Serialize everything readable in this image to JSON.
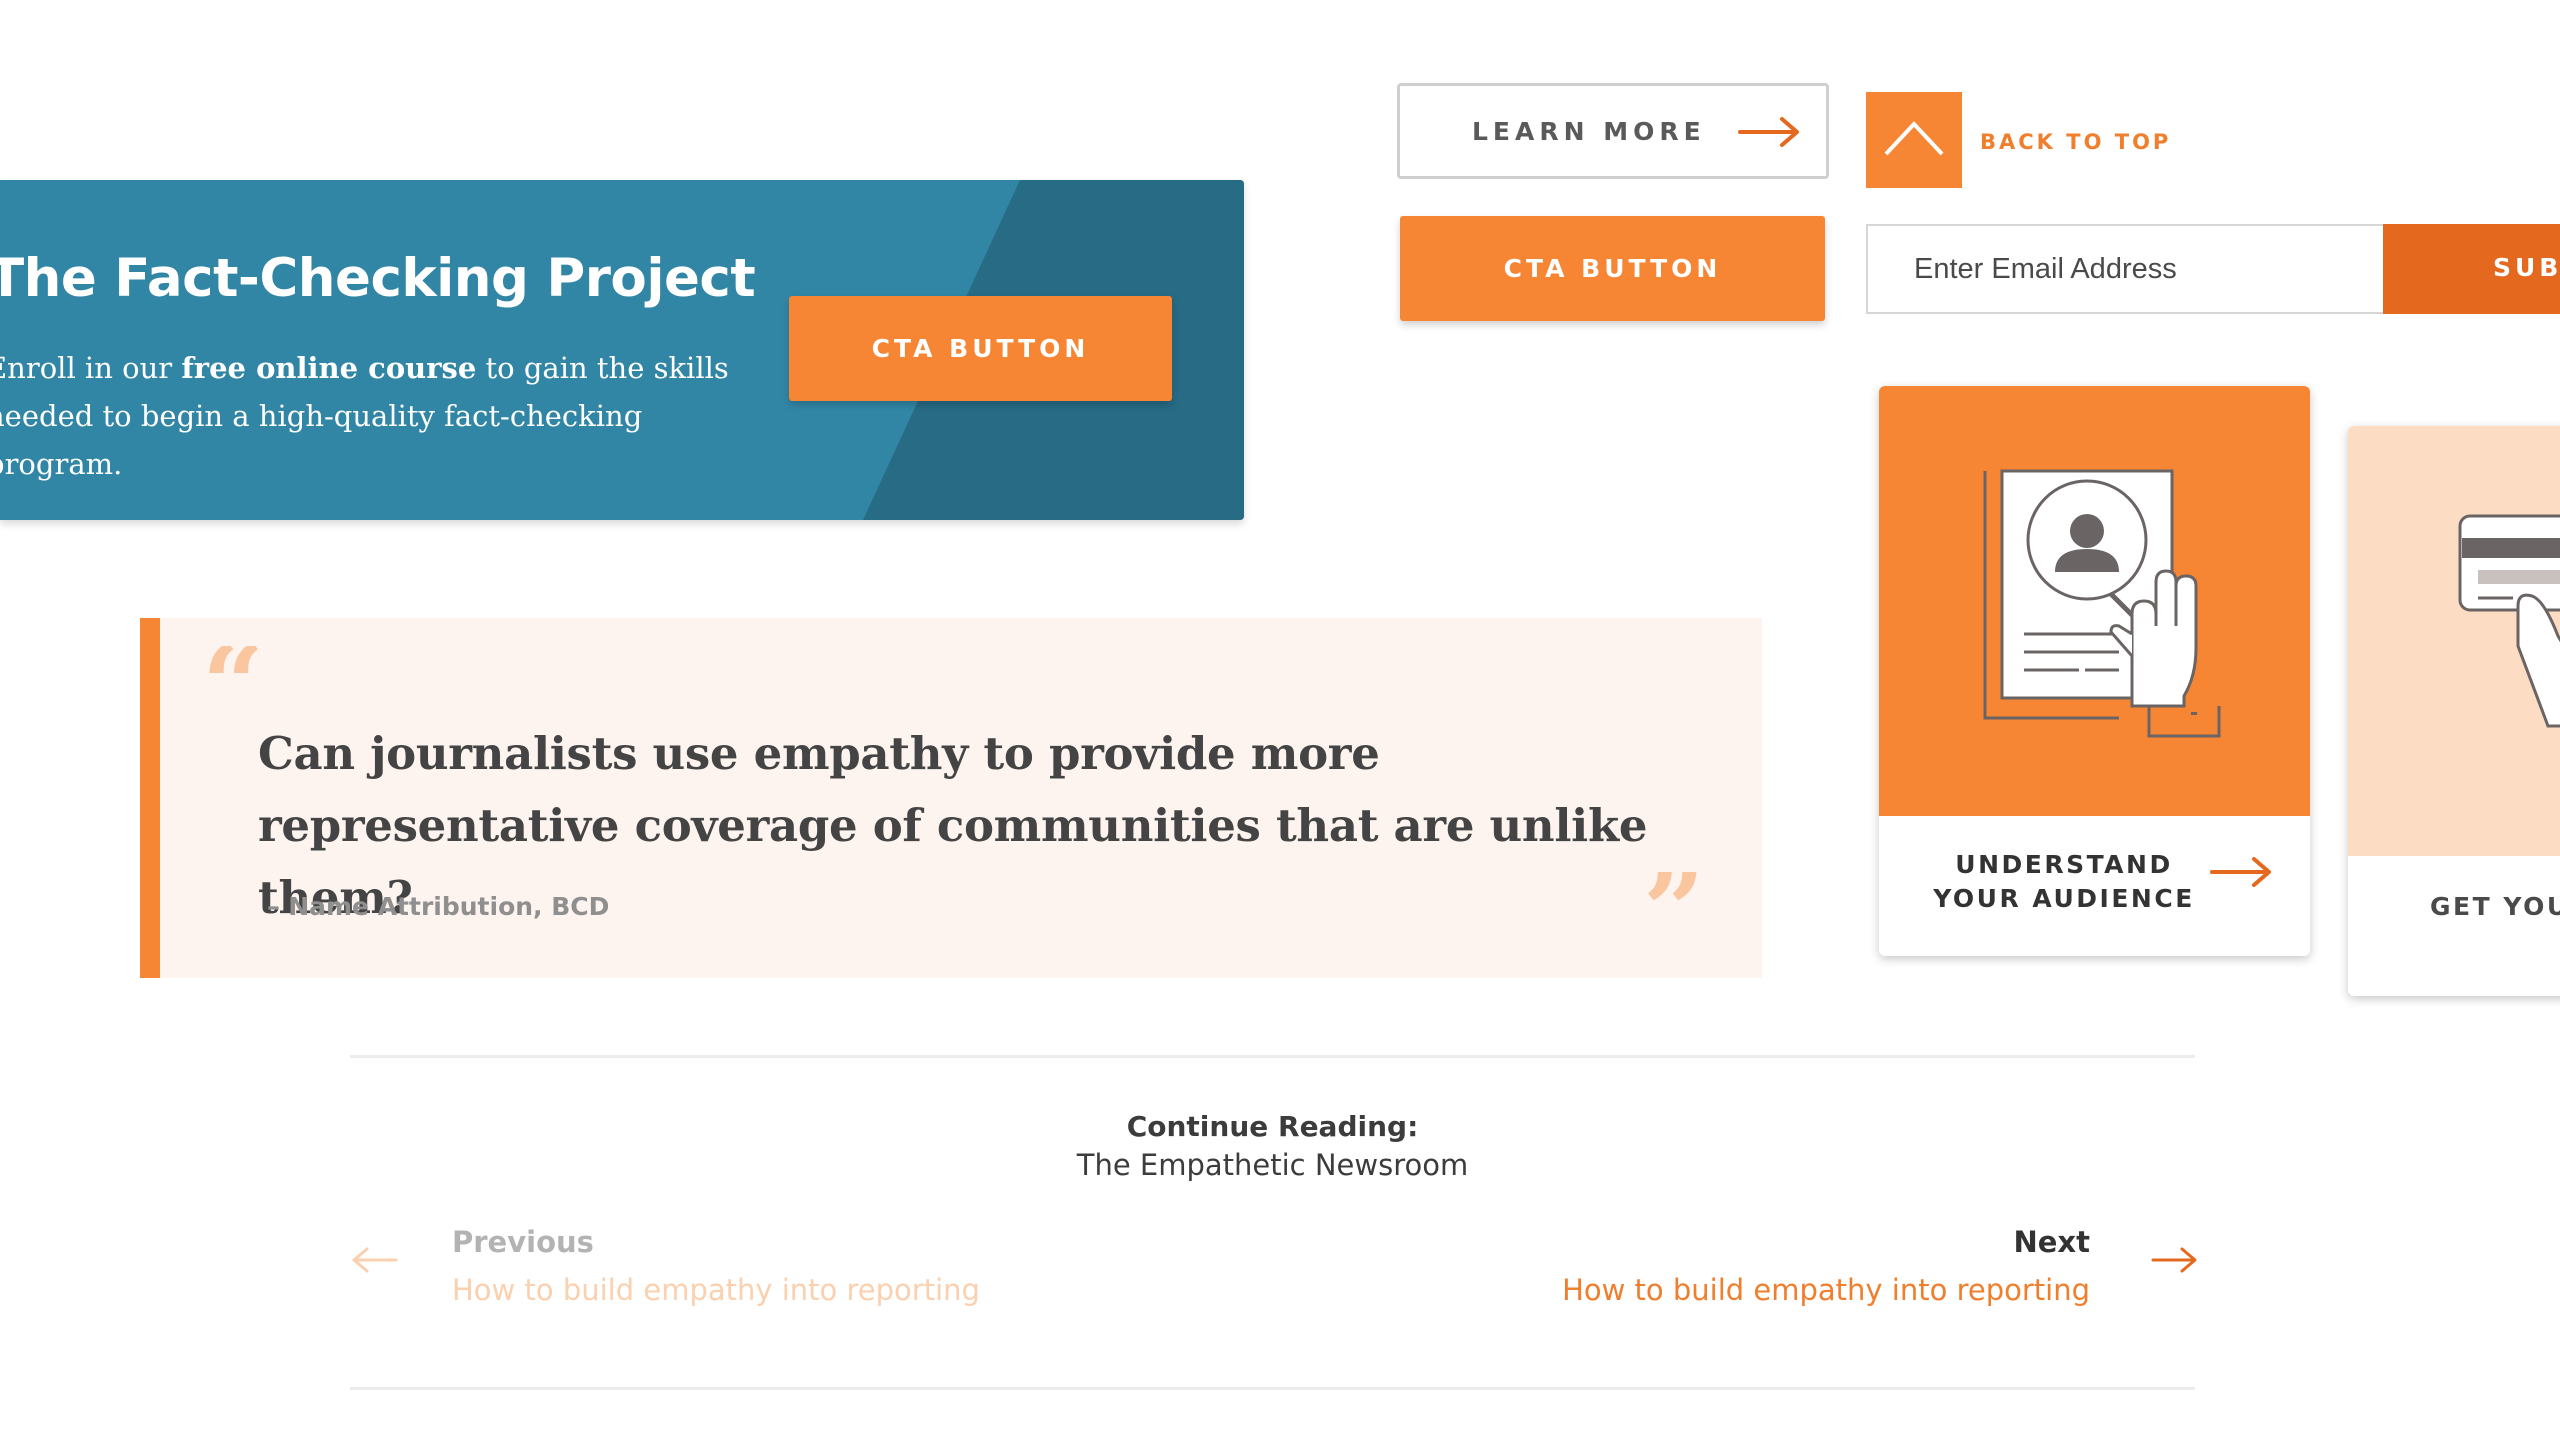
{
  "colors": {
    "accent_orange": "#f68634",
    "dark_orange": "#e4691e",
    "banner_blue": "#3186a6",
    "banner_dark_blue": "#276b85",
    "quote_background": "#fdf3ef",
    "peach": "#fddcc4"
  },
  "buttons": {
    "learn_more": "LEARN MORE",
    "cta": "CTA BUTTON",
    "back_to_top": "BACK TO TOP"
  },
  "icons": {
    "learn_more": "arrow-right-icon",
    "back_to_top": "chevron-up-icon",
    "quote_open": "open-quote-icon",
    "quote_close": "close-quote-icon",
    "card": "arrow-right-icon",
    "previous": "arrow-left-icon",
    "next": "arrow-right-icon"
  },
  "subscribe": {
    "placeholder": "Enter Email Address",
    "button_label": "SUBSCRIBE"
  },
  "banner": {
    "title": "The Fact-Checking Project",
    "desc_before": "Enroll in our ",
    "desc_bold": "free online course",
    "desc_after": " to gain the skills needed to begin a high-quality fact-checking program.",
    "cta_label": "CTA BUTTON"
  },
  "quote": {
    "text": "Can journalists use empathy to provide more representative coverage of communities that are unlike them?",
    "attribution": "– Name Attribution, BCD"
  },
  "cards": [
    {
      "title": "UNDERSTAND YOUR AUDIENCE",
      "illustration": "profile-document-magnifier-icon"
    },
    {
      "title": "GET YOUR AUDIENCE",
      "illustration": "credit-card-hand-icon"
    }
  ],
  "continue_reading": {
    "label": "Continue Reading:",
    "series": "The Empathetic Newsroom",
    "previous": {
      "label": "Previous",
      "title": "How to build empathy into  reporting"
    },
    "next": {
      "label": "Next",
      "title": "How to build empathy into  reporting"
    }
  }
}
